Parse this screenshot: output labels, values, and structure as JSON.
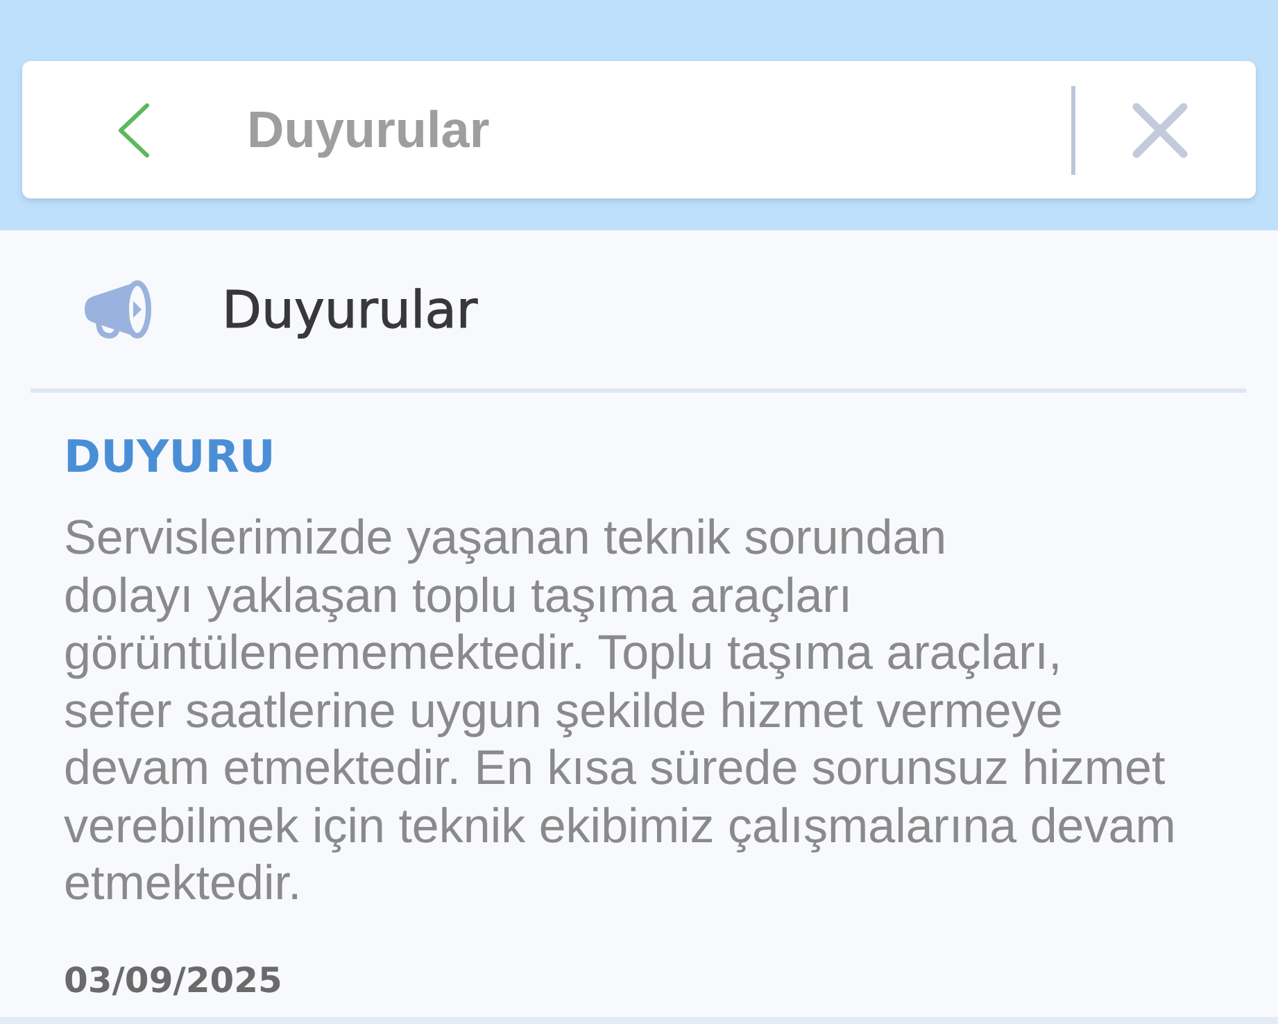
{
  "app_bar": {
    "title": "Duyurular"
  },
  "section": {
    "title": "Duyurular"
  },
  "announcements": [
    {
      "label": "DUYURU",
      "body": "Servislerimizde yaşanan teknik sorundan\ndolayı yaklaşan toplu taşıma araçları\ngörüntülenememektedir. Toplu taşıma araçları,\nsefer saatlerine uygun şekilde hizmet vermeye\ndevam etmektedir. En kısa sürede sorunsuz hizmet\nverebilmek için teknik ekibimiz çalışmalarına devam\netmektedir.",
      "date": "03/09/2025"
    }
  ]
}
